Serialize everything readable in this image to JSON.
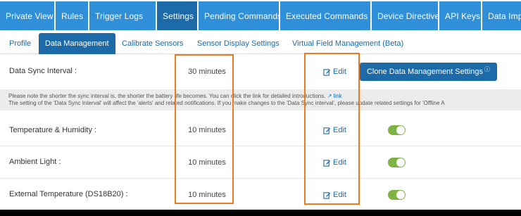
{
  "nav": {
    "tabs": [
      {
        "label": "Private View",
        "active": false
      },
      {
        "label": "Rules",
        "active": false
      },
      {
        "label": "Trigger Logs",
        "active": false
      },
      {
        "label": "Settings",
        "active": true
      },
      {
        "label": "Pending Commands",
        "active": false
      },
      {
        "label": "Executed Commands",
        "active": false
      },
      {
        "label": "Device Directive",
        "active": false
      },
      {
        "label": "API Keys",
        "active": false
      },
      {
        "label": "Data Import/E",
        "active": false
      }
    ]
  },
  "subtabs": [
    {
      "label": "Profile",
      "active": false
    },
    {
      "label": "Data Management",
      "active": true
    },
    {
      "label": "Calibrate Sensors",
      "active": false
    },
    {
      "label": "Sensor Display Settings",
      "active": false
    },
    {
      "label": "Virtual Field Management (Beta)",
      "active": false
    }
  ],
  "sync": {
    "label": "Data Sync Interval :",
    "value": "30 minutes",
    "edit_label": "Edit"
  },
  "clone_button": {
    "label": "Clone Data Management Settings",
    "icon": "question-circle-icon"
  },
  "note": {
    "line1": "Please note the shorter the sync interval is, the shorter the battery life becomes. You can click the link for detailed introductions.",
    "link_label": "link",
    "line2": "The setting of the 'Data Sync Interval' will affect the 'alerts' and related notifications. If you make changes to the 'Data Sync interval', please update related settings for 'Offline A"
  },
  "sensors": [
    {
      "label": "Temperature & Humidity :",
      "value": "10 minutes",
      "edit_label": "Edit",
      "enabled": true
    },
    {
      "label": "Ambient Light :",
      "value": "10 minutes",
      "edit_label": "Edit",
      "enabled": true
    },
    {
      "label": "External Temperature (DS18B20) :",
      "value": "10 minutes",
      "edit_label": "Edit",
      "enabled": true
    }
  ],
  "colors": {
    "tab_blue": "#2f8fd8",
    "tab_active": "#1c6aa8",
    "toggle_on": "#7cb342",
    "highlight": "#f07a20"
  }
}
